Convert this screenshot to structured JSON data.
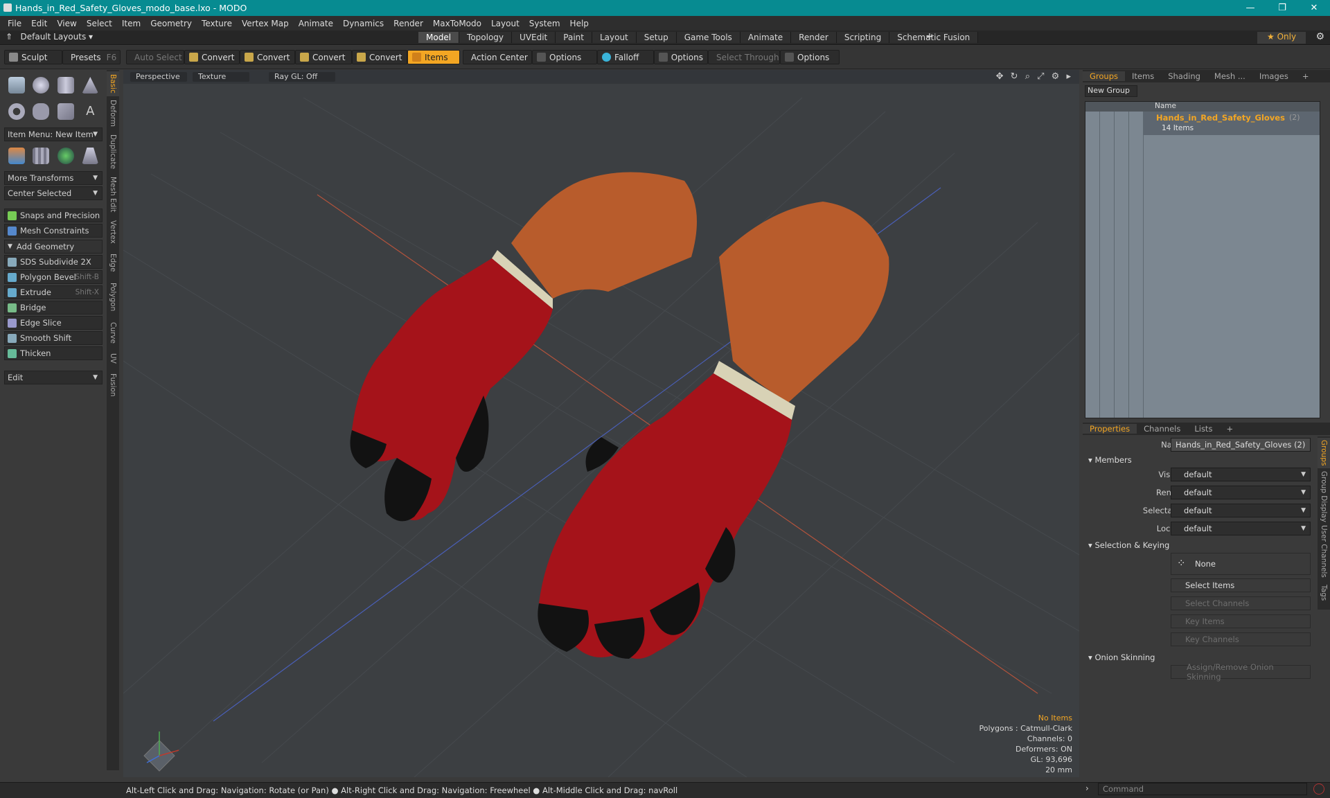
{
  "window": {
    "title": "Hands_in_Red_Safety_Gloves_modo_base.lxo - MODO",
    "minimize": "—",
    "maximize": "❐",
    "close": "✕"
  },
  "menu": [
    "File",
    "Edit",
    "View",
    "Select",
    "Item",
    "Geometry",
    "Texture",
    "Vertex Map",
    "Animate",
    "Dynamics",
    "Render",
    "MaxToModo",
    "Layout",
    "System",
    "Help"
  ],
  "layoutbar": {
    "layouts": "Default Layouts",
    "tabs": [
      "Model",
      "Topology",
      "UVEdit",
      "Paint",
      "Layout",
      "Setup",
      "Game Tools",
      "Animate",
      "Render",
      "Scripting",
      "Schematic Fusion"
    ],
    "active_tab": "Model",
    "only": "Only"
  },
  "toolbar": {
    "sculpt": "Sculpt",
    "presets": "Presets",
    "presets_key": "F6",
    "auto_select": "Auto Select",
    "convert1": "Convert",
    "convert2": "Convert",
    "convert3": "Convert",
    "convert4": "Convert",
    "items": "Items",
    "action_center": "Action Center",
    "options1": "Options",
    "falloff": "Falloff",
    "options2": "Options",
    "select_through": "Select Through",
    "options3": "Options"
  },
  "left": {
    "item_menu": "Item Menu: New Item",
    "more_transforms": "More Transforms",
    "center_selected": "Center Selected",
    "snaps": "Snaps and Precision",
    "mesh_constraints": "Mesh Constraints",
    "add_geometry": "Add Geometry",
    "tools": [
      {
        "label": "SDS Subdivide 2X",
        "key": ""
      },
      {
        "label": "Polygon Bevel",
        "key": "Shift-B"
      },
      {
        "label": "Extrude",
        "key": "Shift-X"
      },
      {
        "label": "Bridge",
        "key": ""
      },
      {
        "label": "Edge Slice",
        "key": ""
      },
      {
        "label": "Smooth Shift",
        "key": ""
      },
      {
        "label": "Thicken",
        "key": ""
      }
    ],
    "edit": "Edit",
    "vtabs": [
      "Basic",
      "Deform",
      "Duplicate",
      "Mesh Edit",
      "Vertex",
      "Edge",
      "Polygon",
      "Curve",
      "UV",
      "Fusion"
    ]
  },
  "viewport": {
    "perspective": "Perspective",
    "texture": "Texture",
    "raygl": "Ray GL: Off",
    "stats": {
      "no_items": "No Items",
      "polygons": "Polygons : Catmull-Clark",
      "channels": "Channels: 0",
      "deformers": "Deformers: ON",
      "gl": "GL: 93,696",
      "scale": "20 mm"
    }
  },
  "status": "Alt-Left Click and Drag: Navigation: Rotate (or Pan) ● Alt-Right Click and Drag: Navigation: Freewheel ● Alt-Middle Click and Drag: navRoll",
  "groups_panel": {
    "tabs": [
      "Groups",
      "Items",
      "Shading",
      "Mesh ...",
      "Images"
    ],
    "new_group": "New Group",
    "col_name": "Name",
    "group_name": "Hands_in_Red_Safety_Gloves",
    "group_count": "(2)",
    "group_items": "14 Items"
  },
  "props_panel": {
    "tabs": [
      "Properties",
      "Channels",
      "Lists"
    ],
    "name_label": "Name",
    "name_value": "Hands_in_Red_Safety_Gloves (2)",
    "members": "Members",
    "visible": "Visible",
    "render": "Render",
    "selectable": "Selectable",
    "locked": "Locked",
    "default": "default",
    "sel_keying": "Selection & Keying",
    "none": "None",
    "select_items": "Select Items",
    "select_channels": "Select Channels",
    "key_items": "Key Items",
    "key_channels": "Key Channels",
    "onion": "Onion Skinning",
    "assign_onion": "Assign/Remove Onion Skinning",
    "rtabs": [
      "Groups",
      "Group Display",
      "User Channels",
      "Tags"
    ]
  },
  "command": {
    "placeholder": "Command"
  },
  "colors": {
    "accent": "#f3a623",
    "title": "#078b91",
    "glove_red": "#a5131a",
    "glove_black": "#121212",
    "skin": "#b85c2c"
  }
}
